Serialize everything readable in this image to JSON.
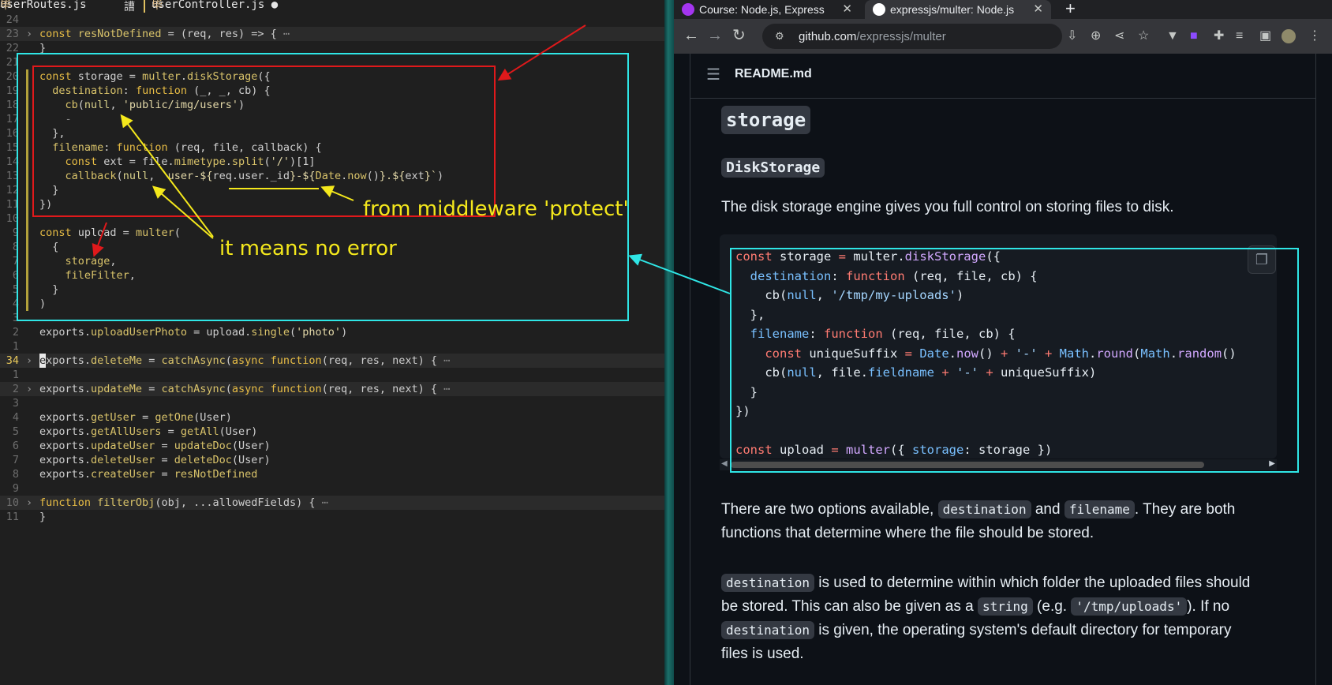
{
  "editor": {
    "tabs": [
      {
        "icon": "毕",
        "label": "userRoutes.js"
      },
      {
        "icon": "",
        "label": "䜊"
      },
      {
        "icon": "毕",
        "label": "userController.js"
      }
    ],
    "modified_dot": "●",
    "lines": [
      {
        "num": "24",
        "fold": false,
        "parts": []
      },
      {
        "num": "23",
        "fold": true,
        "parts": [
          [
            "k",
            "const "
          ],
          [
            "f",
            "resNotDefined"
          ],
          [
            "p",
            " = (req, res) => { "
          ],
          [
            "dim",
            "⋯"
          ]
        ]
      },
      {
        "num": "22",
        "fold": false,
        "parts": [
          [
            "p",
            "}"
          ]
        ]
      },
      {
        "num": "21",
        "fold": false,
        "parts": []
      },
      {
        "num": "20",
        "fold": false,
        "parts": [
          [
            "k",
            "const "
          ],
          [
            "p",
            "storage = "
          ],
          [
            "f",
            "multer"
          ],
          [
            "p",
            "."
          ],
          [
            "f",
            "diskStorage"
          ],
          [
            "p",
            "({"
          ]
        ]
      },
      {
        "num": "19",
        "fold": false,
        "parts": [
          [
            "f",
            "  destination"
          ],
          [
            "p",
            ": "
          ],
          [
            "k",
            "function "
          ],
          [
            "p",
            "(_, _, cb) {"
          ]
        ]
      },
      {
        "num": "18",
        "fold": false,
        "parts": [
          [
            "p",
            "    "
          ],
          [
            "f",
            "cb"
          ],
          [
            "p",
            "("
          ],
          [
            "n",
            "null"
          ],
          [
            "p",
            ", "
          ],
          [
            "s",
            "'public/img/users'"
          ],
          [
            "p",
            ")"
          ]
        ]
      },
      {
        "num": "17",
        "fold": false,
        "parts": [
          [
            "dim",
            "    -"
          ]
        ]
      },
      {
        "num": "16",
        "fold": false,
        "parts": [
          [
            "p",
            "  },"
          ]
        ]
      },
      {
        "num": "15",
        "fold": false,
        "parts": [
          [
            "f",
            "  filename"
          ],
          [
            "p",
            ": "
          ],
          [
            "k",
            "function "
          ],
          [
            "p",
            "(req, file, callback) {"
          ]
        ]
      },
      {
        "num": "14",
        "fold": false,
        "parts": [
          [
            "k",
            "    const "
          ],
          [
            "p",
            "ext = file."
          ],
          [
            "f",
            "mimetype"
          ],
          [
            "p",
            "."
          ],
          [
            "f",
            "split"
          ],
          [
            "p",
            "("
          ],
          [
            "s",
            "'/'"
          ],
          [
            "p",
            ")[1]"
          ]
        ]
      },
      {
        "num": "13",
        "fold": false,
        "parts": [
          [
            "p",
            "    "
          ],
          [
            "f",
            "callback"
          ],
          [
            "p",
            "("
          ],
          [
            "n",
            "null"
          ],
          [
            "p",
            ", "
          ],
          [
            "s",
            "`user-${"
          ],
          [
            "p",
            "req.user._id"
          ],
          [
            "s",
            "}-${"
          ],
          [
            "f",
            "Date"
          ],
          [
            "p",
            "."
          ],
          [
            "f",
            "now"
          ],
          [
            "p",
            "()"
          ],
          [
            "s",
            "}.${"
          ],
          [
            "p",
            "ext"
          ],
          [
            "s",
            "}`"
          ],
          [
            "p",
            ")"
          ]
        ]
      },
      {
        "num": "12",
        "fold": false,
        "parts": [
          [
            "p",
            "  }"
          ]
        ]
      },
      {
        "num": "11",
        "fold": false,
        "parts": [
          [
            "p",
            "})"
          ]
        ]
      },
      {
        "num": "10",
        "fold": false,
        "parts": []
      },
      {
        "num": "9",
        "fold": false,
        "parts": [
          [
            "k",
            "const "
          ],
          [
            "p",
            "upload = "
          ],
          [
            "f",
            "multer"
          ],
          [
            "p",
            "("
          ]
        ]
      },
      {
        "num": "8",
        "fold": false,
        "parts": [
          [
            "p",
            "  {"
          ]
        ]
      },
      {
        "num": "7",
        "fold": false,
        "parts": [
          [
            "f",
            "    storage"
          ],
          [
            "p",
            ","
          ]
        ]
      },
      {
        "num": "6",
        "fold": false,
        "parts": [
          [
            "f",
            "    fileFilter"
          ],
          [
            "p",
            ","
          ]
        ]
      },
      {
        "num": "5",
        "fold": false,
        "parts": [
          [
            "p",
            "  }"
          ]
        ]
      },
      {
        "num": "4",
        "fold": false,
        "parts": [
          [
            "p",
            ")"
          ]
        ]
      },
      {
        "num": "3",
        "fold": false,
        "parts": []
      },
      {
        "num": "2",
        "fold": false,
        "parts": [
          [
            "p",
            "exports."
          ],
          [
            "f",
            "uploadUserPhoto"
          ],
          [
            "p",
            " = upload."
          ],
          [
            "f",
            "single"
          ],
          [
            "p",
            "("
          ],
          [
            "s",
            "'photo'"
          ],
          [
            "p",
            ")"
          ]
        ]
      },
      {
        "num": "1",
        "fold": false,
        "parts": []
      },
      {
        "num": "34",
        "fold": true,
        "current": true,
        "parts": [
          [
            "cursor",
            "e"
          ],
          [
            "p",
            "xports."
          ],
          [
            "f",
            "deleteMe"
          ],
          [
            "p",
            " = "
          ],
          [
            "f",
            "catchAsync"
          ],
          [
            "p",
            "("
          ],
          [
            "k",
            "async function"
          ],
          [
            "p",
            "(req, res, next) { "
          ],
          [
            "dim",
            "⋯"
          ]
        ]
      },
      {
        "num": "1",
        "fold": false,
        "parts": []
      },
      {
        "num": "2",
        "fold": true,
        "parts": [
          [
            "p",
            "exports."
          ],
          [
            "f",
            "updateMe"
          ],
          [
            "p",
            " = "
          ],
          [
            "f",
            "catchAsync"
          ],
          [
            "p",
            "("
          ],
          [
            "k",
            "async function"
          ],
          [
            "p",
            "(req, res, next) { "
          ],
          [
            "dim",
            "⋯"
          ]
        ]
      },
      {
        "num": "3",
        "fold": false,
        "parts": []
      },
      {
        "num": "4",
        "fold": false,
        "parts": [
          [
            "p",
            "exports."
          ],
          [
            "f",
            "getUser"
          ],
          [
            "p",
            " = "
          ],
          [
            "f",
            "getOne"
          ],
          [
            "p",
            "(User)"
          ]
        ]
      },
      {
        "num": "5",
        "fold": false,
        "parts": [
          [
            "p",
            "exports."
          ],
          [
            "f",
            "getAllUsers"
          ],
          [
            "p",
            " = "
          ],
          [
            "f",
            "getAll"
          ],
          [
            "p",
            "(User)"
          ]
        ]
      },
      {
        "num": "6",
        "fold": false,
        "parts": [
          [
            "p",
            "exports."
          ],
          [
            "f",
            "updateUser"
          ],
          [
            "p",
            " = "
          ],
          [
            "f",
            "updateDoc"
          ],
          [
            "p",
            "(User)"
          ]
        ]
      },
      {
        "num": "7",
        "fold": false,
        "parts": [
          [
            "p",
            "exports."
          ],
          [
            "f",
            "deleteUser"
          ],
          [
            "p",
            " = "
          ],
          [
            "f",
            "deleteDoc"
          ],
          [
            "p",
            "(User)"
          ]
        ]
      },
      {
        "num": "8",
        "fold": false,
        "parts": [
          [
            "p",
            "exports."
          ],
          [
            "f",
            "createUser"
          ],
          [
            "p",
            " = "
          ],
          [
            "f",
            "resNotDefined"
          ]
        ]
      },
      {
        "num": "9",
        "fold": false,
        "parts": []
      },
      {
        "num": "10",
        "fold": true,
        "parts": [
          [
            "k",
            "function "
          ],
          [
            "f",
            "filterObj"
          ],
          [
            "p",
            "(obj, ...allowedFields) { "
          ],
          [
            "dim",
            "⋯"
          ]
        ]
      },
      {
        "num": "11",
        "fold": false,
        "parts": [
          [
            "p",
            "}"
          ]
        ]
      }
    ]
  },
  "annotations": {
    "note_middleware": "from middleware 'protect'",
    "note_no_error": "it means no error",
    "colors": {
      "red": "#e0191b",
      "yellow": "#f4e81c",
      "cyan": "#2fe6e6"
    }
  },
  "browser": {
    "tabs": [
      {
        "title": "Course: Node.js, Express",
        "active": false,
        "icon_color": "#a435f0"
      },
      {
        "title": "expressjs/multer: Node.js",
        "active": true,
        "icon_color": "#ffffff"
      }
    ],
    "new_tab": "+",
    "url_host": "github.com",
    "url_path": "/expressjs/multer",
    "readme_title": "README.md",
    "heading_storage": "storage",
    "heading_diskstorage": "DiskStorage",
    "intro": "The disk storage engine gives you full control on storing files to disk.",
    "code_lines": [
      [
        [
          "gk",
          "const "
        ],
        [
          "",
          "storage "
        ],
        [
          "gk",
          "= "
        ],
        [
          "",
          "multer."
        ],
        [
          "gf",
          "diskStorage"
        ],
        [
          "",
          "({"
        ]
      ],
      [
        [
          "",
          "  "
        ],
        [
          "gc",
          "destination"
        ],
        [
          "",
          ": "
        ],
        [
          "gk",
          "function "
        ],
        [
          "",
          "(req, file, cb) {"
        ]
      ],
      [
        [
          "",
          "    cb("
        ],
        [
          "gc",
          "null"
        ],
        [
          "",
          ", "
        ],
        [
          "gs",
          "'/tmp/my-uploads'"
        ],
        [
          "",
          ")"
        ]
      ],
      [
        [
          "",
          "  },"
        ]
      ],
      [
        [
          "",
          "  "
        ],
        [
          "gc",
          "filename"
        ],
        [
          "",
          ": "
        ],
        [
          "gk",
          "function "
        ],
        [
          "",
          "(req, file, cb) {"
        ]
      ],
      [
        [
          "",
          "    "
        ],
        [
          "gk",
          "const "
        ],
        [
          "",
          "uniqueSuffix "
        ],
        [
          "gk",
          "= "
        ],
        [
          "gc",
          "Date"
        ],
        [
          "",
          "."
        ],
        [
          "gf",
          "now"
        ],
        [
          "",
          "() "
        ],
        [
          "gk",
          "+ "
        ],
        [
          "gs",
          "'-' "
        ],
        [
          "gk",
          "+ "
        ],
        [
          "gc",
          "Math"
        ],
        [
          "",
          "."
        ],
        [
          "gf",
          "round"
        ],
        [
          "",
          "("
        ],
        [
          "gc",
          "Math"
        ],
        [
          "",
          "."
        ],
        [
          "gf",
          "random"
        ],
        [
          "",
          "()"
        ]
      ],
      [
        [
          "",
          "    cb("
        ],
        [
          "gc",
          "null"
        ],
        [
          "",
          ", file."
        ],
        [
          "gc",
          "fieldname"
        ],
        [
          "gk",
          " + "
        ],
        [
          "gs",
          "'-' "
        ],
        [
          "gk",
          "+ "
        ],
        [
          "",
          "uniqueSuffix)"
        ]
      ],
      [
        [
          "",
          "  }"
        ]
      ],
      [
        [
          "",
          "})"
        ]
      ],
      [
        [
          "",
          ""
        ]
      ],
      [
        [
          "gk",
          "const "
        ],
        [
          "",
          "upload "
        ],
        [
          "gk",
          "= "
        ],
        [
          "gf",
          "multer"
        ],
        [
          "",
          "({ "
        ],
        [
          "gc",
          "storage"
        ],
        [
          "",
          ": storage })"
        ]
      ]
    ],
    "para1_a": "There are two options available, ",
    "para1_code1": "destination",
    "para1_b": " and ",
    "para1_code2": "filename",
    "para1_c": ". They are both",
    "para1_d": "functions that determine where the file should be stored.",
    "para2_code1": "destination",
    "para2_a": " is used to determine within which folder the uploaded files should",
    "para2_b": "be stored. This can also be given as a ",
    "para2_code2": "string",
    "para2_c": " (e.g. ",
    "para2_code3": "'/tmp/uploads'",
    "para2_d": "). If no",
    "para2_code4": "destination",
    "para2_e": " is given, the operating system's default directory for temporary",
    "para2_f": "files is used."
  }
}
